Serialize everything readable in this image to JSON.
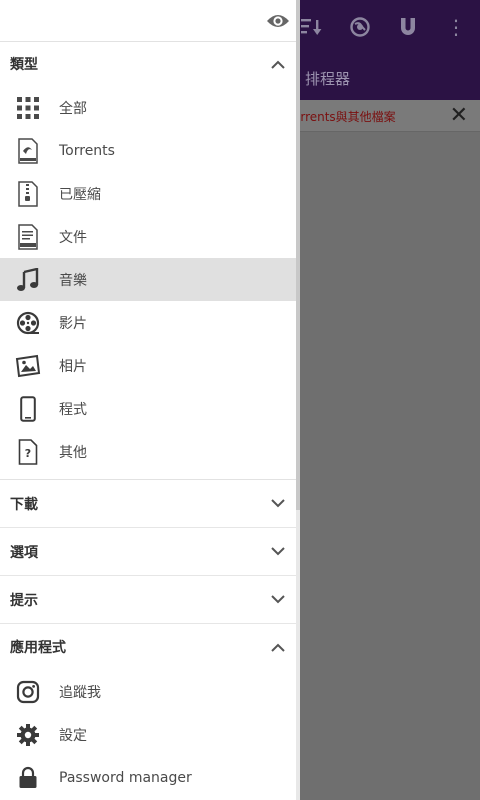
{
  "background": {
    "subtitle": "排程器",
    "banner_text": "orrents與其他檔案",
    "close_label": "✕",
    "more_label": "⋮",
    "icons": [
      "sort-icon",
      "globe-icon",
      "magnet-icon",
      "more-vert-icon"
    ]
  },
  "drawer": {
    "top_icon": "eye-icon",
    "sections": {
      "types": {
        "title": "類型",
        "items": [
          {
            "label": "全部",
            "icon": "grid-icon"
          },
          {
            "label": "Torrents",
            "icon": "torrent-file-icon"
          },
          {
            "label": "已壓縮",
            "icon": "zip-file-icon"
          },
          {
            "label": "文件",
            "icon": "doc-file-icon"
          },
          {
            "label": "音樂",
            "icon": "music-icon"
          },
          {
            "label": "影片",
            "icon": "film-reel-icon"
          },
          {
            "label": "相片",
            "icon": "photo-icon"
          },
          {
            "label": "程式",
            "icon": "phone-icon"
          },
          {
            "label": "其他",
            "icon": "unknown-file-icon"
          }
        ]
      },
      "downloads": {
        "title": "下載"
      },
      "options": {
        "title": "選項"
      },
      "tips": {
        "title": "提示"
      },
      "apps": {
        "title": "應用程式",
        "items": [
          {
            "label": "追蹤我",
            "icon": "instagram-icon"
          },
          {
            "label": "設定",
            "icon": "gear-icon"
          },
          {
            "label": "Password manager",
            "icon": "lock-icon"
          }
        ]
      }
    }
  },
  "colors": {
    "appbar": "#2b1244",
    "overlay": "#6f6f6f",
    "active_item": "#e0e0e0",
    "banner_text": "#7a1010"
  }
}
